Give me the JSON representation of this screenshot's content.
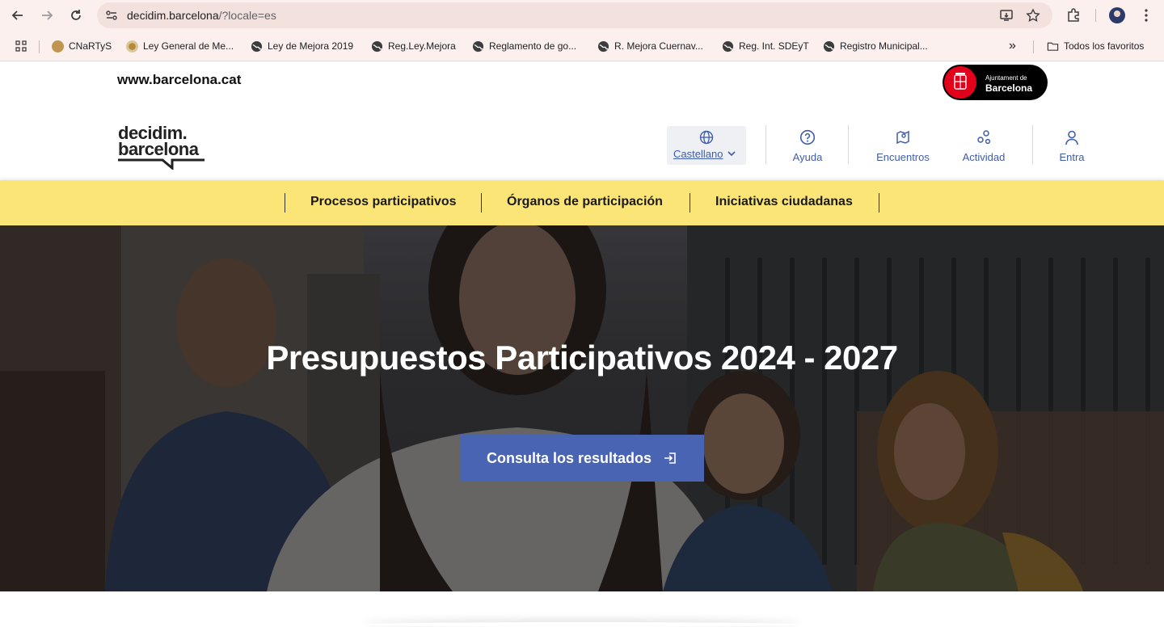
{
  "browser": {
    "url_host": "decidim.barcelona",
    "url_path": "/?locale=es",
    "bookmarks": [
      {
        "label": "CNaRTyS"
      },
      {
        "label": "Ley General de Me..."
      },
      {
        "label": "Ley de Mejora 2019"
      },
      {
        "label": "Reg.Ley.Mejora"
      },
      {
        "label": "Reglamento de go..."
      },
      {
        "label": "R. Mejora Cuernav..."
      },
      {
        "label": "Reg. Int. SDEyT"
      },
      {
        "label": "Registro Municipal..."
      }
    ],
    "more_label": "»",
    "all_favorites": "Todos los favoritos"
  },
  "topbar": {
    "site_link": "www.barcelona.cat",
    "ajuntament_line1": "Ajuntament de",
    "ajuntament_line2": "Barcelona"
  },
  "header": {
    "logo_line1": "decidim.",
    "logo_line2": "barcelona",
    "language": "Castellano",
    "nav": [
      {
        "label": "Ayuda",
        "icon": "help-circle-icon"
      },
      {
        "label": "Encuentros",
        "icon": "map-pin-icon"
      },
      {
        "label": "Actividad",
        "icon": "activity-icon"
      },
      {
        "label": "Entra",
        "icon": "user-icon"
      }
    ]
  },
  "main_nav": [
    {
      "label": "Procesos participativos"
    },
    {
      "label": "Órganos de participación"
    },
    {
      "label": "Iniciativas ciudadanas"
    }
  ],
  "hero": {
    "title": "Presupuestos Participativos 2024 - 2027",
    "cta": "Consulta los resultados"
  },
  "colors": {
    "accent_blue": "#4a64b4",
    "nav_yellow": "#fce577",
    "link_blue": "#3f5dab",
    "ajuntament_red": "#e2001a"
  }
}
